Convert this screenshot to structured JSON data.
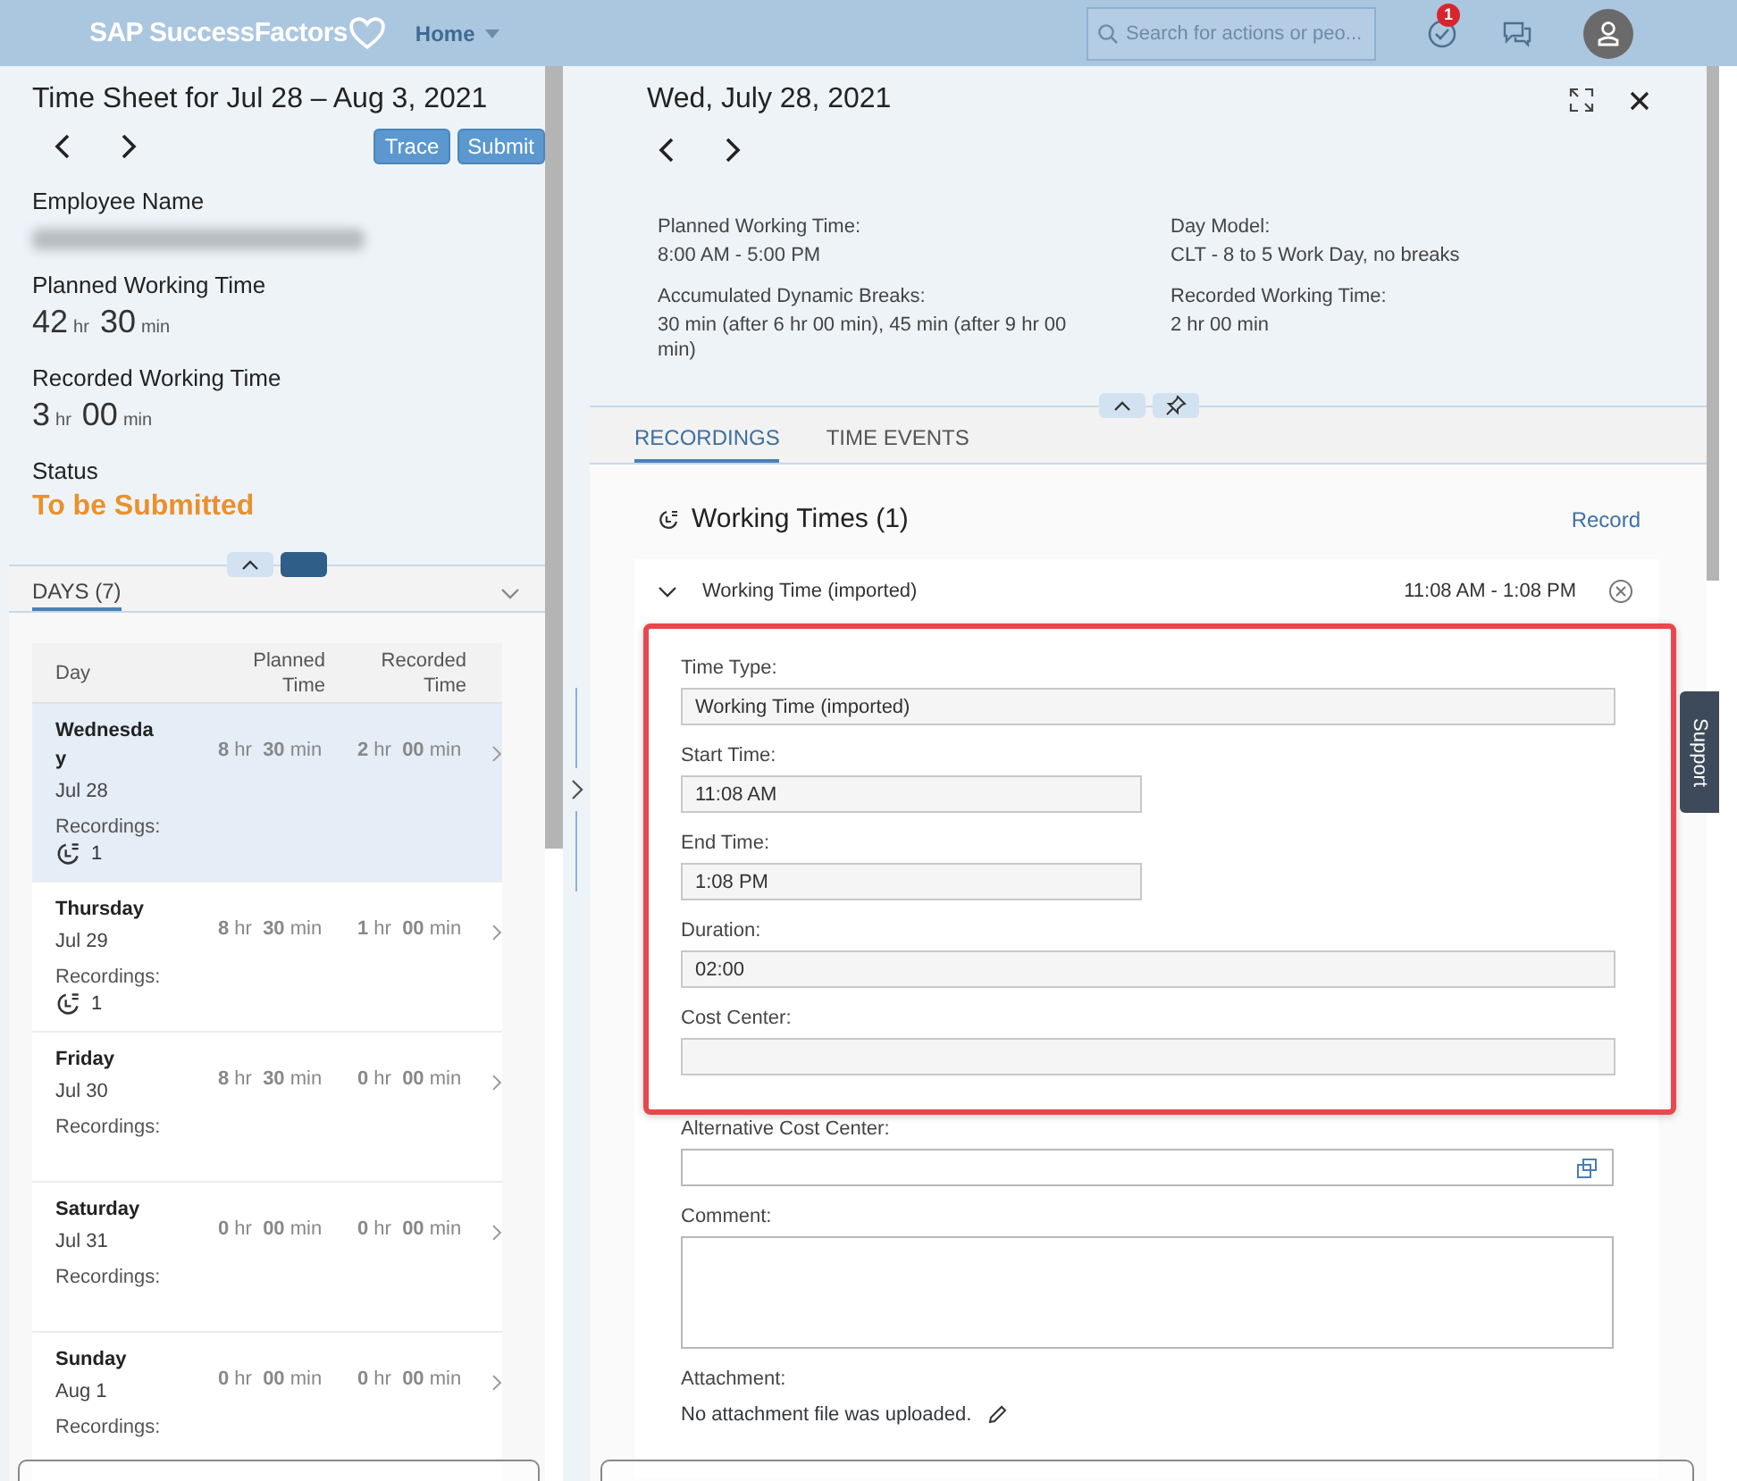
{
  "header": {
    "logo": "SAP SuccessFactors",
    "nav": "Home",
    "search": {
      "placeholder": "Search for actions or peo..."
    },
    "notification_count": "1"
  },
  "timesheet": {
    "title": "Time Sheet for Jul 28 – Aug 3, 2021",
    "buttons": [
      "Trace",
      "Submit"
    ],
    "summary": [
      {
        "kind": "redacted",
        "label": "Employee Name"
      },
      {
        "kind": "duration",
        "label": "Planned Working Time",
        "parts": [
          {
            "value": "42",
            "unit": "hr"
          },
          {
            "value": "30",
            "unit": "min"
          }
        ]
      },
      {
        "kind": "duration",
        "label": "Recorded Working Time",
        "parts": [
          {
            "value": "3",
            "unit": "hr"
          },
          {
            "value": "00",
            "unit": "min"
          }
        ]
      },
      {
        "kind": "status",
        "label": "Status",
        "value": "To be Submitted"
      }
    ],
    "days_tab": "DAYS (7)",
    "columns": [
      "Day",
      "Planned Time",
      "Recorded Time"
    ],
    "days": [
      {
        "day": "Wednesday",
        "date": "Jul 28",
        "planned": "**8** hr  **30** min",
        "recorded": "**2** hr  **00** min",
        "recordings_label": "Recordings:",
        "recordings_count": "1",
        "selected": true
      },
      {
        "day": "Thursday",
        "date": "Jul 29",
        "planned": "**8** hr  **30** min",
        "recorded": "**1** hr  **00** min",
        "recordings_label": "Recordings:",
        "recordings_count": "1",
        "selected": false
      },
      {
        "day": "Friday",
        "date": "Jul 30",
        "planned": "**8** hr  **30** min",
        "recorded": "**0** hr  **00** min",
        "recordings_label": "Recordings:",
        "selected": false
      },
      {
        "day": "Saturday",
        "date": "Jul 31",
        "planned": "**0** hr  **00** min",
        "recorded": "**0** hr  **00** min",
        "recordings_label": "Recordings:",
        "selected": false
      },
      {
        "day": "Sunday",
        "date": "Aug 1",
        "planned": "**0** hr  **00** min",
        "recorded": "**0** hr  **00** min",
        "recordings_label": "Recordings:",
        "selected": false
      }
    ]
  },
  "day_detail": {
    "title": "Wed, July 28, 2021",
    "details": [
      {
        "label": "Planned Working Time:",
        "value": "8:00 AM - 5:00 PM"
      },
      {
        "label": "Day Model:",
        "value": "CLT - 8 to 5 Work Day, no breaks"
      },
      {
        "label": "Accumulated Dynamic Breaks:",
        "value": "30 min (after 6 hr 00 min), 45 min (after 9 hr 00 min)"
      },
      {
        "label": "Recorded Working Time:",
        "value": "2 hr 00 min"
      }
    ],
    "tabs": [
      {
        "label": "RECORDINGS",
        "selected": true
      },
      {
        "label": "TIME EVENTS",
        "selected": false
      }
    ],
    "section": {
      "title": "Working Times (1)",
      "action": "Record"
    },
    "entry": {
      "title": "Working Time (imported)",
      "time": "11:08 AM - 1:08 PM",
      "expanded": true
    },
    "fields": [
      {
        "kind": "readonly",
        "label": "Time Type:",
        "value": "Working Time (imported)",
        "highlighted": true
      },
      {
        "kind": "readonly_short",
        "label": "Start Time:",
        "value": "11:08 AM",
        "highlighted": true
      },
      {
        "kind": "readonly_short",
        "label": "End Time:",
        "value": " 1:08 PM",
        "highlighted": true
      },
      {
        "kind": "readonly",
        "label": "Duration:",
        "value": "02:00",
        "highlighted": true
      },
      {
        "kind": "readonly",
        "label": "Cost Center:",
        "highlighted": true
      },
      {
        "kind": "lookup",
        "label": "Alternative Cost Center:",
        "highlighted": false
      },
      {
        "kind": "textarea",
        "label": "Comment:",
        "highlighted": false
      }
    ],
    "attachment": {
      "label": "Attachment:",
      "text": "No attachment file was uploaded."
    }
  },
  "support_tab": "Support"
}
